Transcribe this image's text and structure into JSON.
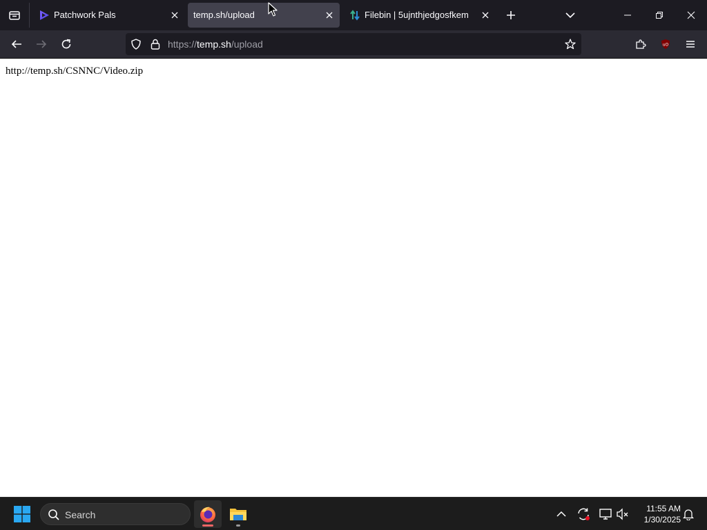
{
  "browser": {
    "tabs": [
      {
        "label": "Patchwork Pals",
        "icon": "play-triangle-icon",
        "active": false
      },
      {
        "label": "temp.sh/upload",
        "icon": "none",
        "active": true
      },
      {
        "label": "Filebin | 5ujnthjedgosfkem",
        "icon": "updown-arrows-icon",
        "active": false
      }
    ],
    "url": {
      "scheme": "https://",
      "host": "temp.sh",
      "path": "/upload"
    }
  },
  "page": {
    "result_text": "http://temp.sh/CSNNC/Video.zip"
  },
  "taskbar": {
    "search_label": "Search",
    "time": "11:55 AM",
    "date": "1/30/2025"
  },
  "colors": {
    "tab_strip": "#1c1b22",
    "nav_bar": "#2b2a33",
    "active_tab": "#42414d",
    "taskbar": "#1c1c1c",
    "firefox_indicator": "#e66"
  }
}
